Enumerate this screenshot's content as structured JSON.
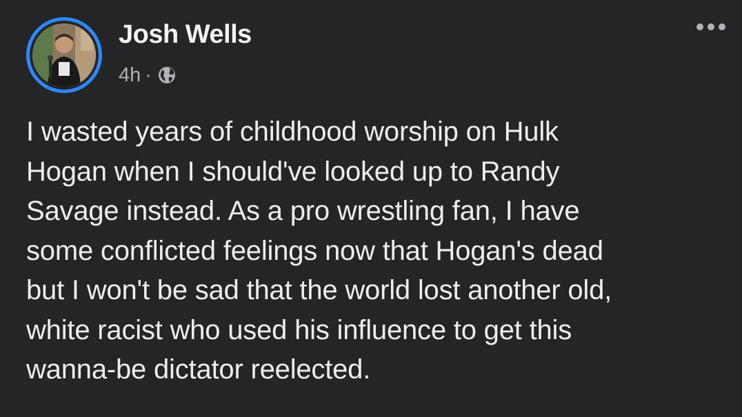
{
  "post": {
    "author": "Josh Wells",
    "time": "4h",
    "separator": "·",
    "privacy_icon": "globe-icon",
    "more_icon": "more-options-icon",
    "text": "I wasted years of childhood worship on Hulk\nHogan when I should've looked up to Randy\nSavage instead. As a pro wrestling fan, I have\nsome conflicted feelings now that Hogan's dead\nbut I won't be sad that the world lost another old,\nwhite racist who used his influence to get this\nwanna-be dictator reelected."
  },
  "colors": {
    "background": "#242526",
    "avatar_ring": "#2d88ff",
    "primary_text": "#e4e6eb",
    "secondary_text": "#b0b3b8"
  }
}
